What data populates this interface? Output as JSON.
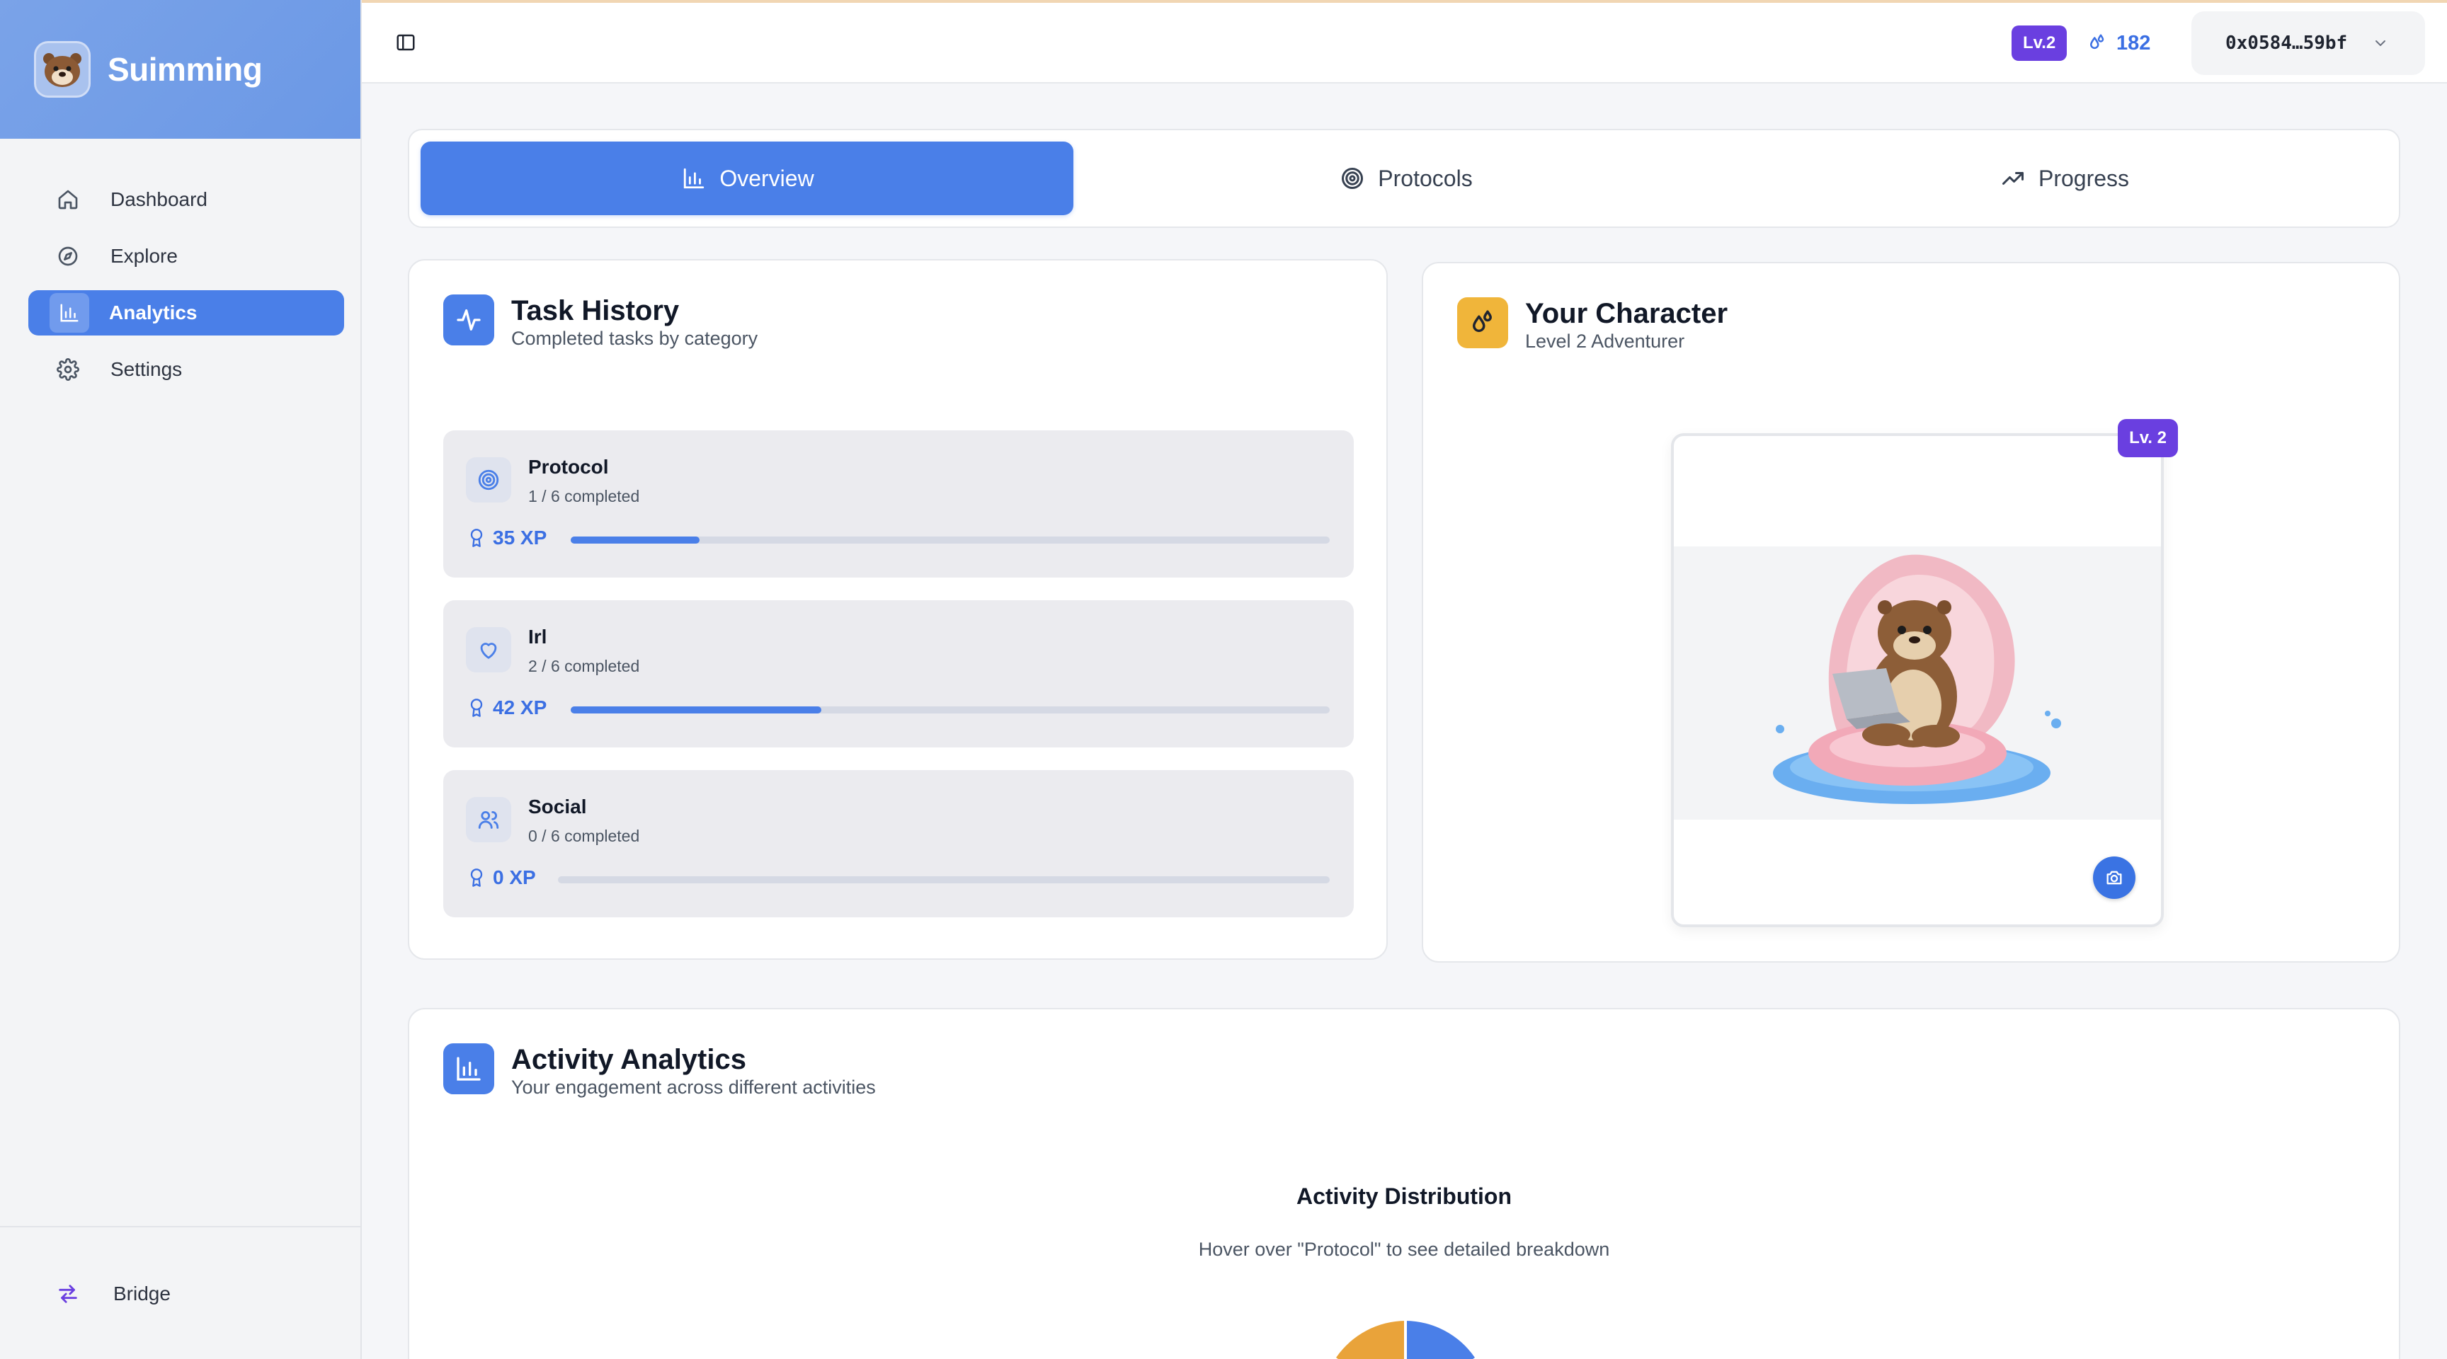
{
  "app": {
    "name": "Suimming"
  },
  "sidebar": {
    "items": [
      {
        "label": "Dashboard",
        "icon": "home-icon",
        "active": false
      },
      {
        "label": "Explore",
        "icon": "compass-icon",
        "active": false
      },
      {
        "label": "Analytics",
        "icon": "bar-chart-icon",
        "active": true
      },
      {
        "label": "Settings",
        "icon": "gear-icon",
        "active": false
      }
    ],
    "bottom": {
      "label": "Bridge",
      "icon": "swap-arrows-icon"
    }
  },
  "header": {
    "level_badge": "Lv.2",
    "drops": "182",
    "wallet": "0x0584…59bf"
  },
  "tabs": [
    {
      "label": "Overview",
      "icon": "bar-chart-icon",
      "active": true
    },
    {
      "label": "Protocols",
      "icon": "target-icon",
      "active": false
    },
    {
      "label": "Progress",
      "icon": "trending-up-icon",
      "active": false
    }
  ],
  "task_history": {
    "title": "Task History",
    "subtitle": "Completed tasks by category",
    "items": [
      {
        "name": "Protocol",
        "count": "1 / 6 completed",
        "xp": "35 XP",
        "progress": 0.17,
        "icon": "target-icon"
      },
      {
        "name": "Irl",
        "count": "2 / 6 completed",
        "xp": "42 XP",
        "progress": 0.33,
        "icon": "heart-icon"
      },
      {
        "name": "Social",
        "count": "0 / 6 completed",
        "xp": "0 XP",
        "progress": 0,
        "icon": "users-icon"
      }
    ]
  },
  "character": {
    "title": "Your Character",
    "subtitle": "Level 2 Adventurer",
    "level_badge": "Lv. 2"
  },
  "activity": {
    "title": "Activity Analytics",
    "subtitle": "Your engagement across different activities",
    "chart_title": "Activity Distribution",
    "chart_hint": "Hover over \"Protocol\" to see detailed breakdown"
  },
  "colors": {
    "accent": "#4a7fe8",
    "level_purple": "#6a3fe0",
    "character_icon_bg": "#f0b53a",
    "pie_orange": "#e9a33a",
    "pie_blue": "#4a7fe8"
  }
}
